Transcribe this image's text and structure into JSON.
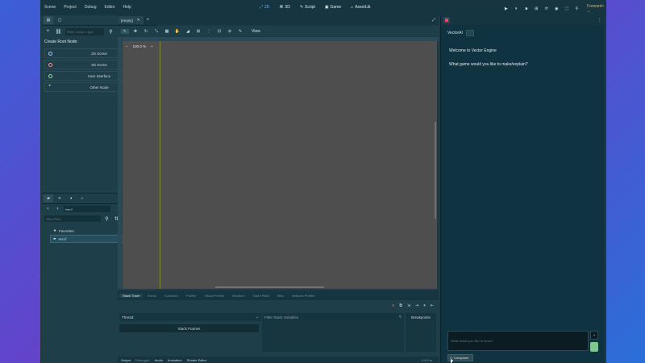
{
  "menu": [
    "Scene",
    "Project",
    "Debug",
    "Editor",
    "Help"
  ],
  "modes": [
    {
      "label": "2D",
      "glyph": "⤢"
    },
    {
      "label": "3D",
      "glyph": "⌘"
    },
    {
      "label": "Script",
      "glyph": "✎"
    },
    {
      "label": "Game",
      "glyph": "▣"
    },
    {
      "label": "AssetLib",
      "glyph": "⌂"
    }
  ],
  "play_controls": [
    "▶",
    "⏸",
    "■",
    "⊞",
    "⟳",
    "◉",
    "⬚",
    "⚲"
  ],
  "renderer": "Forward+ ⌄",
  "scene_dock": {
    "filter_placeholder": "Filter: name, t:type",
    "create_root_title": "Create Root Node:",
    "root_buttons": [
      "2D Scene",
      "3D Scene",
      "User Interface",
      "Other Node"
    ],
    "root_colors": [
      "#a3c6ff",
      "#ff8f8f",
      "#8fe08f",
      "#cfdce2"
    ]
  },
  "filesystem": {
    "path": "res://",
    "filter_placeholder": "Filter Files",
    "items": [
      "Favorites:",
      "res://"
    ]
  },
  "editor": {
    "tab_label": "[empty]",
    "zoom": "100.0 %",
    "view_menu": "View"
  },
  "bottom": {
    "tabs": [
      "Stack Trace",
      "Errors",
      "Evaluator",
      "Profiler",
      "Visual Profiler",
      "Monitors",
      "Video RAM",
      "Misc",
      "Network Profiler"
    ],
    "thread_label": "Thread:",
    "stack_frames": "Stack Frames",
    "filter_vars_placeholder": "Filter Stack Variables",
    "breakpoints": "Breakpoints",
    "status_tabs": [
      "Output",
      "Debugger",
      "Audio",
      "Animation",
      "Shader Editor"
    ],
    "version": "4.4.2.rc"
  },
  "ai_panel": {
    "title": "VectorAI",
    "welcome": "Welcome to Vector Engine",
    "question": "What game would you like to make/explain?",
    "input_placeholder": "What would you like to know?",
    "composer_label": "Composer",
    "side_button": "+"
  }
}
